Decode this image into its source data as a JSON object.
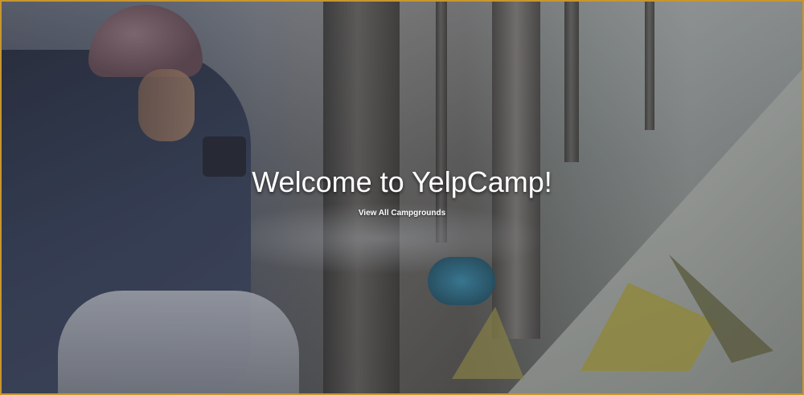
{
  "hero": {
    "title": "Welcome to YelpCamp!",
    "link_label": "View All Campgrounds"
  },
  "colors": {
    "frame_border": "#c8962e",
    "text": "#ffffff"
  },
  "background": {
    "image_description_icon": "hero-background-photo"
  }
}
